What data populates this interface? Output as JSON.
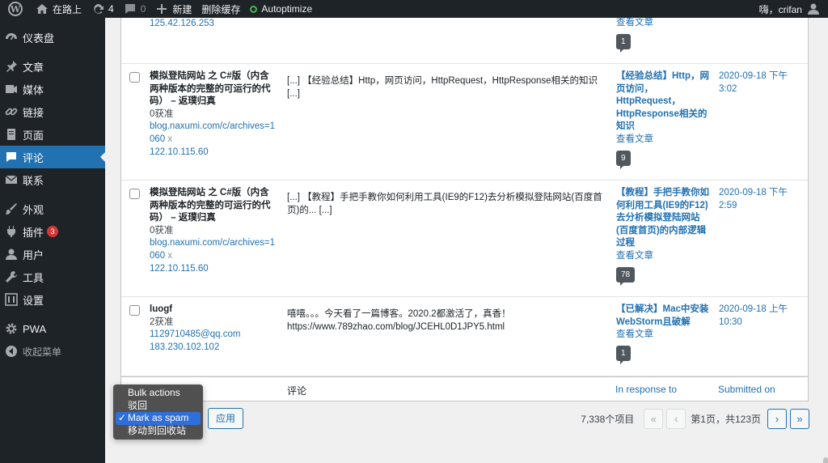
{
  "adminbar": {
    "site_name": "在路上",
    "updates_count": "4",
    "comments_count": "0",
    "new_label": "新建",
    "clear_cache_label": "删除缓存",
    "autoptimize_label": "Autoptimize",
    "greeting": "嗨，crifan"
  },
  "sidebar": {
    "items": [
      {
        "label": "仪表盘"
      },
      {
        "label": "文章"
      },
      {
        "label": "媒体"
      },
      {
        "label": "链接"
      },
      {
        "label": "页面"
      },
      {
        "label": "评论"
      },
      {
        "label": "联系"
      },
      {
        "label": "外观"
      },
      {
        "label": "插件",
        "badge": "3"
      },
      {
        "label": "用户"
      },
      {
        "label": "工具"
      },
      {
        "label": "设置"
      },
      {
        "label": "PWA"
      },
      {
        "label": "收起菜单"
      }
    ]
  },
  "table": {
    "first_row": {
      "ip": "125.42.126.253",
      "view_post": "查看文章",
      "bubble": "1"
    },
    "rows": [
      {
        "author_name": "模拟登陆网站 之 C#版（内含两种版本的完整的可运行的代码） – 返璞归真",
        "approved": "0获准",
        "url1": "blog.naxumi.com/c/archives=1",
        "url2": "060",
        "x": "x",
        "ip": "122.10.115.60",
        "comment": "[...] 【经验总结】Http，网页访问，HttpRequest，HttpResponse相关的知识 [...]",
        "post_title": "【经验总结】Http，网页访问，HttpRequest，HttpResponse相关的知识",
        "view_post": "查看文章",
        "bubble": "9",
        "date": "2020-09-18 下午3:02"
      },
      {
        "author_name": "模拟登陆网站 之 C#版（内含两种版本的完整的可运行的代码） – 返璞归真",
        "approved": "0获准",
        "url1": "blog.naxumi.com/c/archives=1",
        "url2": "060",
        "x": "x",
        "ip": "122.10.115.60",
        "comment": "[...] 【教程】手把手教你如何利用工具(IE9的F12)去分析模拟登陆网站(百度首页)的... [...]",
        "post_title": "【教程】手把手教你如何利用工具(IE9的F12)去分析模拟登陆网站(百度首页)的内部逻辑过程",
        "view_post": "查看文章",
        "bubble": "78",
        "date": "2020-09-18 下午2:59"
      },
      {
        "author_name": "luogf",
        "approved": "2获准",
        "email": "1129710485@qq.com",
        "ip": "183.230.102.102",
        "comment_line1": "嘻嘻。。。今天看了一篇博客。2020.2都激活了，真香！",
        "comment_line2": "https://www.789zhao.com/blog/JCEHL0D1JPY5.html",
        "post_title": "【已解决】Mac中安装WebStorm且破解",
        "view_post": "查看文章",
        "bubble": "1",
        "date": "2020-09-18 上午10:30"
      }
    ],
    "footer": {
      "comment_col": "评论",
      "response_col": "In response to",
      "submitted_col": "Submitted on"
    }
  },
  "bulk": {
    "options": [
      "Bulk actions",
      "驳回",
      "Mark as spam",
      "移动到回收站"
    ],
    "selected_check": "✓",
    "apply_label": "应用"
  },
  "pagination": {
    "count": "7,338个项目",
    "first": "«",
    "prev": "‹",
    "page_text": "第1页，共123页",
    "next": "›",
    "last": "»"
  }
}
